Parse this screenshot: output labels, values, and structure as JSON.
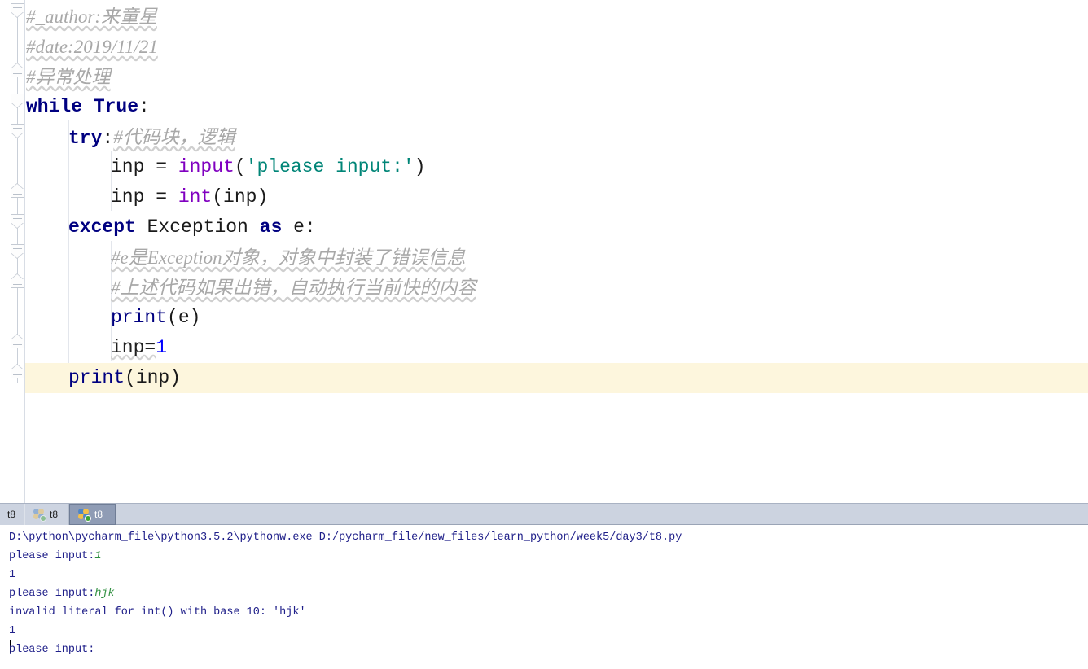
{
  "editor": {
    "lines": [
      {
        "id": "line-author-comment",
        "tokens": [
          {
            "kind": "comment",
            "text": "#_author:来童星"
          }
        ]
      },
      {
        "id": "line-date-comment",
        "tokens": [
          {
            "kind": "comment",
            "text": "#date:2019/11/21"
          }
        ]
      },
      {
        "id": "line-topic-comment",
        "tokens": [
          {
            "kind": "comment",
            "text": "#异常处理"
          }
        ]
      },
      {
        "id": "line-while-true",
        "tokens": [
          {
            "kind": "kw",
            "text": "while"
          },
          {
            "kind": "plain",
            "text": " "
          },
          {
            "kind": "kw",
            "text": "True"
          },
          {
            "kind": "plain",
            "text": ":"
          }
        ]
      },
      {
        "id": "line-try",
        "tokens": [
          {
            "kind": "kw",
            "text": "try"
          },
          {
            "kind": "plain",
            "text": ":"
          },
          {
            "kind": "comment",
            "text": "#代码块，逻辑"
          }
        ]
      },
      {
        "id": "line-inp-input",
        "tokens": [
          {
            "kind": "plain",
            "text": "inp = "
          },
          {
            "kind": "builtin",
            "text": "input"
          },
          {
            "kind": "plain",
            "text": "("
          },
          {
            "kind": "str",
            "text": "'please input:'"
          },
          {
            "kind": "plain",
            "text": ")"
          }
        ]
      },
      {
        "id": "line-inp-int",
        "tokens": [
          {
            "kind": "plain",
            "text": "inp = "
          },
          {
            "kind": "builtin",
            "text": "int"
          },
          {
            "kind": "plain",
            "text": "(inp)"
          }
        ]
      },
      {
        "id": "line-except",
        "tokens": [
          {
            "kind": "kw",
            "text": "except"
          },
          {
            "kind": "plain",
            "text": " Exception "
          },
          {
            "kind": "kw",
            "text": "as"
          },
          {
            "kind": "plain",
            "text": " e:"
          }
        ]
      },
      {
        "id": "line-comment-e-object",
        "tokens": [
          {
            "kind": "comment",
            "text": "#e是Exception对象，对象中封装了错误信息"
          }
        ]
      },
      {
        "id": "line-comment-auto-exec",
        "tokens": [
          {
            "kind": "comment",
            "text": "#上述代码如果出错，自动执行当前快的内容"
          }
        ]
      },
      {
        "id": "line-print-e",
        "tokens": [
          {
            "kind": "func",
            "text": "print"
          },
          {
            "kind": "plain",
            "text": "(e)"
          }
        ]
      },
      {
        "id": "line-inp-assign-one",
        "tokens": [
          {
            "kind": "squiggle",
            "text": "inp="
          },
          {
            "kind": "num",
            "text": "1"
          }
        ]
      },
      {
        "id": "line-print-inp",
        "tokens": [
          {
            "kind": "func",
            "text": "print"
          },
          {
            "kind": "plain",
            "text": "(inp)"
          }
        ]
      }
    ]
  },
  "tabs": {
    "items": [
      {
        "id": "tab-t8-plain",
        "label": "t8",
        "icon": "",
        "state": "plain"
      },
      {
        "id": "tab-t8-idle",
        "label": "t8",
        "icon": "python-icon",
        "state": "idle"
      },
      {
        "id": "tab-t8-selected",
        "label": "t8",
        "icon": "python-icon",
        "state": "selected"
      }
    ]
  },
  "console": {
    "lines": [
      {
        "id": "console-command",
        "segments": [
          {
            "kind": "out",
            "text": "D:\\python\\pycharm_file\\python3.5.2\\pythonw.exe D:/pycharm_file/new_files/learn_python/week5/day3/t8.py"
          }
        ]
      },
      {
        "id": "console-prompt-1",
        "segments": [
          {
            "kind": "out",
            "text": "please input:"
          },
          {
            "kind": "in",
            "text": "1"
          }
        ]
      },
      {
        "id": "console-echo-1",
        "segments": [
          {
            "kind": "out",
            "text": "1"
          }
        ]
      },
      {
        "id": "console-prompt-2",
        "segments": [
          {
            "kind": "out",
            "text": "please input:"
          },
          {
            "kind": "in",
            "text": "hjk"
          }
        ]
      },
      {
        "id": "console-error",
        "segments": [
          {
            "kind": "out",
            "text": "invalid literal for int() with base 10: 'hjk'"
          }
        ]
      },
      {
        "id": "console-echo-2",
        "segments": [
          {
            "kind": "out",
            "text": "1"
          }
        ]
      },
      {
        "id": "console-prompt-3",
        "segments": [
          {
            "kind": "out",
            "text": "please input:"
          }
        ]
      }
    ]
  },
  "colors": {
    "keyword": "#000080",
    "builtin": "#8000c0",
    "string": "#008577",
    "number": "#0000ff",
    "comment": "#a8a8a8",
    "console_text": "#20208a",
    "console_input": "#2f8f3f",
    "caret_line": "#fdf6dd",
    "tab_bar": "#ccd3e0",
    "tab_selected": "#8f9cb5"
  }
}
